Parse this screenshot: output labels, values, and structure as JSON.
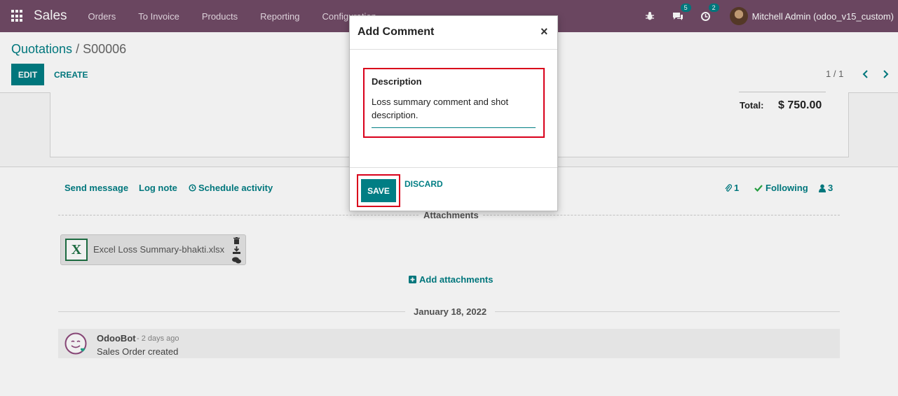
{
  "navbar": {
    "brand": "Sales",
    "menu": [
      "Orders",
      "To Invoice",
      "Products",
      "Reporting",
      "Configuration"
    ],
    "messages_count": "5",
    "activities_count": "2",
    "user": "Mitchell Admin (odoo_v15_custom)"
  },
  "control_panel": {
    "breadcrumb_parent": "Quotations",
    "breadcrumb_separator": " / ",
    "breadcrumb_current": "S00006",
    "edit_label": "EDIT",
    "create_label": "CREATE",
    "pager": "1 / 1"
  },
  "form": {
    "total_label": "Total:",
    "total_value": "$ 750.00"
  },
  "chatter": {
    "send_message": "Send message",
    "log_note": "Log note",
    "schedule_activity": "Schedule activity",
    "attachments_count": "1",
    "following": "Following",
    "followers_count": "3",
    "attachments_title": "Attachments",
    "attachment_name": "Excel Loss Summary-bhakti.xlsx",
    "add_attachments": "Add attachments",
    "date_separator": "January 18, 2022",
    "message": {
      "author": "OdooBot",
      "date": "- 2 days ago",
      "body": "Sales Order created"
    }
  },
  "modal": {
    "title": "Add Comment",
    "close": "×",
    "field_label": "Description",
    "field_value": "Loss summary comment and shot description.",
    "save_label": "SAVE",
    "discard_label": "DISCARD"
  }
}
